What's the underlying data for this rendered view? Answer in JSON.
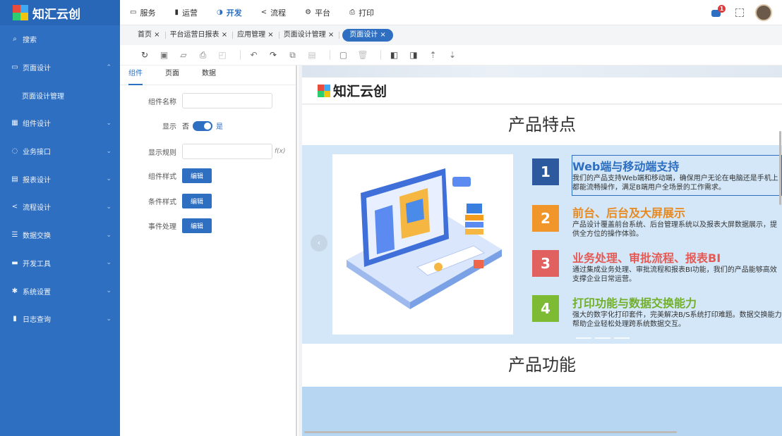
{
  "app": {
    "name": "知汇云创"
  },
  "sidebar": {
    "items": [
      {
        "label": "搜索",
        "icon": "search-icon",
        "symbol": "⌕",
        "chevron": false
      },
      {
        "label": "页面设计",
        "icon": "page-icon",
        "symbol": "▭",
        "chevron": true,
        "chevron_symbol": "⌃"
      },
      {
        "label": "页面设计管理",
        "icon": "",
        "symbol": "",
        "chevron": false,
        "sub": true
      },
      {
        "label": "组件设计",
        "icon": "grid-icon",
        "symbol": "▦",
        "chevron": true,
        "chevron_symbol": "⌄"
      },
      {
        "label": "业务接口",
        "icon": "plug-icon",
        "symbol": "◌",
        "chevron": true,
        "chevron_symbol": "⌄"
      },
      {
        "label": "报表设计",
        "icon": "report-icon",
        "symbol": "▤",
        "chevron": true,
        "chevron_symbol": "⌄"
      },
      {
        "label": "流程设计",
        "icon": "flow-icon",
        "symbol": "<",
        "chevron": true,
        "chevron_symbol": "⌄"
      },
      {
        "label": "数据交换",
        "icon": "database-icon",
        "symbol": "☰",
        "chevron": true,
        "chevron_symbol": "⌄"
      },
      {
        "label": "开发工具",
        "icon": "toolbox-icon",
        "symbol": "▬",
        "chevron": true,
        "chevron_symbol": "⌄"
      },
      {
        "label": "系统设置",
        "icon": "gear-icon",
        "symbol": "✱",
        "chevron": true,
        "chevron_symbol": "⌄"
      },
      {
        "label": "日志查询",
        "icon": "log-icon",
        "symbol": "▮",
        "chevron": true,
        "chevron_symbol": "⌄"
      }
    ]
  },
  "topnav": [
    {
      "label": "服务",
      "icon": "service-icon",
      "symbol": "▭",
      "active": false
    },
    {
      "label": "运营",
      "icon": "operation-icon",
      "symbol": "▮",
      "active": false
    },
    {
      "label": "开发",
      "icon": "dev-icon",
      "symbol": "◑",
      "active": true
    },
    {
      "label": "流程",
      "icon": "flow-icon",
      "symbol": "<",
      "active": false
    },
    {
      "label": "平台",
      "icon": "platform-icon",
      "symbol": "⚙",
      "active": false
    },
    {
      "label": "打印",
      "icon": "print-icon",
      "symbol": "⎙",
      "active": false
    }
  ],
  "topright": {
    "badge": "1"
  },
  "tabs": [
    {
      "label": "首页 ×",
      "active": false
    },
    {
      "label": "平台运营日报表 ×",
      "active": false
    },
    {
      "label": "应用管理 ×",
      "active": false
    },
    {
      "label": "页面设计管理 ×",
      "active": false
    },
    {
      "label": "页面设计 ×",
      "active": true
    }
  ],
  "toolbar": [
    {
      "name": "refresh-icon",
      "symbol": "↻",
      "style": "dark"
    },
    {
      "name": "save-icon",
      "symbol": "▣",
      "style": ""
    },
    {
      "name": "open-folder-icon",
      "symbol": "▱",
      "style": ""
    },
    {
      "name": "print-icon",
      "symbol": "⎙",
      "style": ""
    },
    {
      "name": "preview-icon",
      "symbol": "◰",
      "style": "dis"
    },
    {
      "name": "sep",
      "symbol": "",
      "style": "sep"
    },
    {
      "name": "undo-icon",
      "symbol": "↶",
      "style": ""
    },
    {
      "name": "redo-icon",
      "symbol": "↷",
      "style": "dark"
    },
    {
      "name": "copy-icon",
      "symbol": "⧉",
      "style": ""
    },
    {
      "name": "paste-icon",
      "symbol": "▤",
      "style": "dis"
    },
    {
      "name": "sep",
      "symbol": "",
      "style": "sep"
    },
    {
      "name": "comment-icon",
      "symbol": "▢",
      "style": ""
    },
    {
      "name": "delete-icon",
      "symbol": "🗑",
      "style": "dis"
    },
    {
      "name": "sep",
      "symbol": "",
      "style": "sep"
    },
    {
      "name": "bring-front-icon",
      "symbol": "◧",
      "style": "dark"
    },
    {
      "name": "send-back-icon",
      "symbol": "◨",
      "style": "dark"
    },
    {
      "name": "sort-asc-icon",
      "symbol": "⇡",
      "style": ""
    },
    {
      "name": "sort-desc-icon",
      "symbol": "⇣",
      "style": ""
    }
  ],
  "panel": {
    "tabs": [
      {
        "label": "组件",
        "active": true
      },
      {
        "label": "页面",
        "active": false
      },
      {
        "label": "数据",
        "active": false
      }
    ],
    "name_label": "组件名称",
    "show_label": "显示",
    "show_no": "否",
    "show_yes": "是",
    "rule_label": "显示规则",
    "fx": "f(x)",
    "style_label": "组件样式",
    "cond_label": "条件样式",
    "event_label": "事件处理",
    "edit": "编辑"
  },
  "canvas": {
    "brand": "知汇云创",
    "features_title": "产品特点",
    "functions_title": "产品功能",
    "arrow": "‹",
    "features": [
      {
        "num": "1",
        "title": "Web端与移动端支持",
        "desc": "我们的产品支持Web端和移动端，确保用户无论在电脑还是手机上都能流畅操作，满足B端用户全场景的工作需求。",
        "color": "#2d5a9e",
        "title_color": "#2f6fc1"
      },
      {
        "num": "2",
        "title": "前台、后台及大屏展示",
        "desc": "产品设计覆盖前台系统、后台管理系统以及报表大屏数据展示，提供全方位的操作体验。",
        "color": "#f0962a",
        "title_color": "#e8891f"
      },
      {
        "num": "3",
        "title": "业务处理、审批流程、报表BI",
        "desc": "通过集成业务处理、审批流程和报表BI功能，我们的产品能够高效支撑企业日常运营。",
        "color": "#e0615f",
        "title_color": "#e55a55"
      },
      {
        "num": "4",
        "title": "打印功能与数据交换能力",
        "desc": "强大的数字化打印套件，完美解决B/S系统打印难题。数据交换能力帮助企业轻松处理跨系统数据交互。",
        "color": "#7dbb35",
        "title_color": "#72b02c"
      }
    ]
  }
}
